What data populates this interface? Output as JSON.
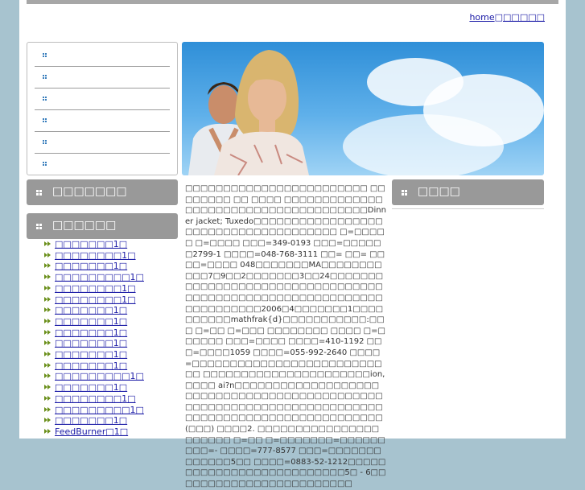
{
  "header": {
    "home_link": "home",
    "second_link": "□□□□□",
    "separator": "□"
  },
  "nav": {
    "items": [
      "",
      "",
      "",
      "",
      "",
      ""
    ]
  },
  "sidebar": {
    "category_title_1": "□□□□□□□",
    "category_title_2": "□□□□□□",
    "links": [
      "□□□□□□□1□",
      "□□□□□□□□1□",
      "□□□□□□□1□",
      "□□□□□□□□□1□",
      "□□□□□□□□1□",
      "□□□□□□□□1□",
      "□□□□□□□1□",
      "□□□□□□□1□",
      "□□□□□□□1□",
      "□□□□□□□1□",
      "□□□□□□□1□",
      "□□□□□□□1□",
      "□□□□□□□□□1□",
      "□□□□□□□1□",
      "□□□□□□□□1□",
      "□□□□□□□□□1□",
      "□□□□□□□1□",
      "FeedBurner□1□"
    ]
  },
  "right": {
    "title": "□□□□"
  },
  "article": {
    "text": "□□□□□□□□□□□□□□□□□□□□□□□□ □□□□□□□□ □□ □□□□ □□□□□□□□□□□□□□□□□□□□□□□□□□□□□□□□□□□□□Dinner jacket; Tuxedo□□□□□□□□□□□□□□□□□□□□□□□□□□□□□□□□□□□□□ □=□□□□□ □=□□□□ □□□=349-0193 □□□=□□□□□□2799-1 □□□□=048-768-3111 □□= □□= □□□□=□□□□ 048□□□□□□□MA□□□□□□□□□□□7□9□□2□□□□□□□3□□24□□□□□□□□□□□□□□□□□□□□□□□□□□□□□□□□□□□□□□□□□□□□□□□□□□□□□□□□□□□□□□□□□□□□□2006□4□□□□□□□1□□□□□□□□□□mathfrak{d}□□□□□□□□□□□:□□□ □=□□ □=□□□ □□□□□□□□ □□□□ □=□□□□□□ □□□=□□□□ □□□□=410-1192 □□□=□□□□1059 □□□□=055-992-2640 □□□□=□□□□□□□□□□□□□□□□□□□□□□□□□□□ □□□□□□□□□□□□□□□□□□□□□□ion, □□□□ ai?n□□□□□□□□□□□□□□□□□□□□□□□□□□□□□□□□□□□□□□□□□□□□□□□□□□□□□□□□□□□□□□□□□□□□□□□□□□□□□□□□□□□□□□□□□□□□□□□□□ (□□□) □□□□2. □□□□□□□□□□□□□□□□□□□□□□ □=□□ □=□□□□□□□=□□□□□□ □□□=- □□□□=777-8577 □□□=□□□□□□□□□□□□□5□□ □□□□=0883-52-1212□□□□□□□□□□□□□□□□□□□□□□□□□□5□ - 6□□□□□□□□□□□□□□□□□□□□□□□□"
  },
  "colors": {
    "background": "#a7c3cf",
    "category_header": "#999999",
    "link": "#1a1aa6",
    "arrow": "#6a8f1a"
  }
}
